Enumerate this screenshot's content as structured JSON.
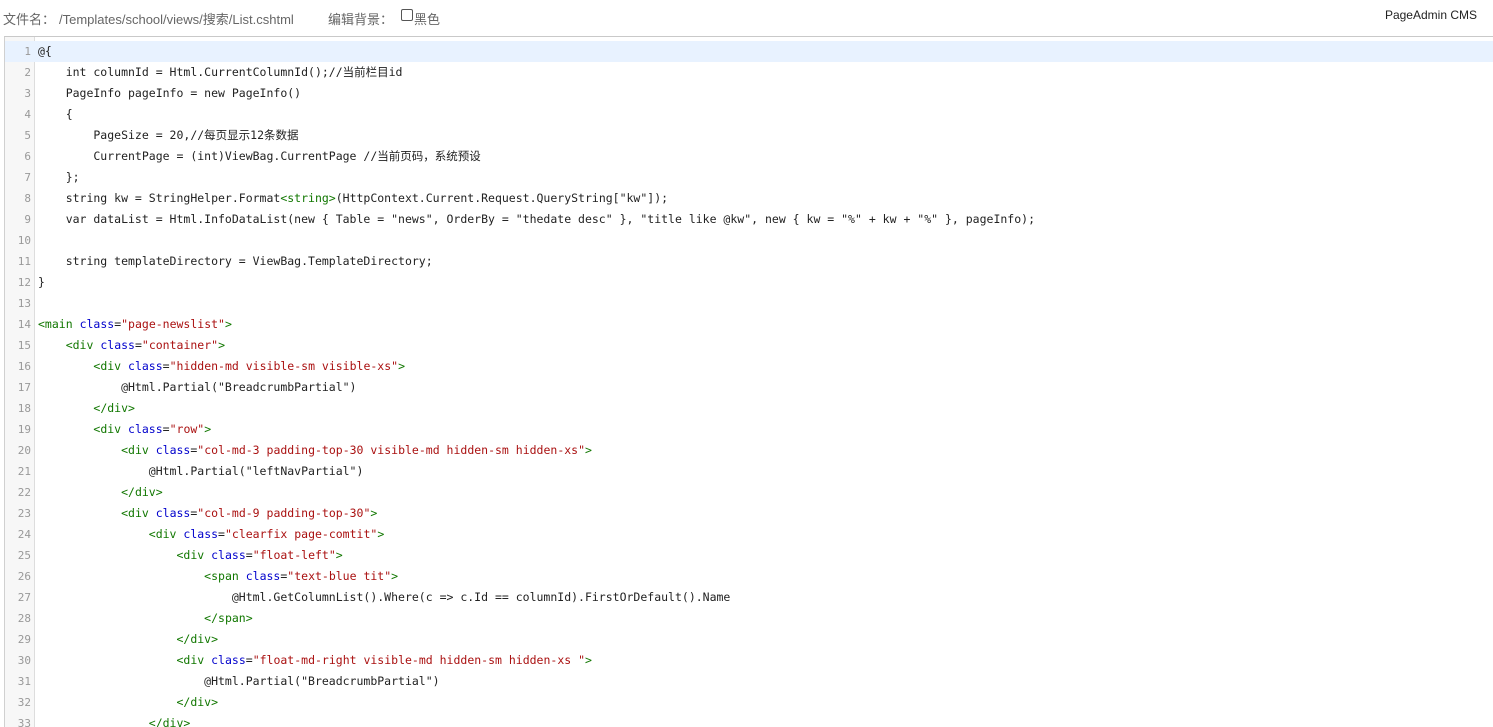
{
  "header": {
    "file_label": "文件名：",
    "file_path": "/Templates/school/views/搜索/List.cshtml",
    "bg_label": "编辑背景：",
    "bg_option": "黑色",
    "bg_checked": false,
    "brand": "PageAdmin CMS"
  },
  "editor": {
    "active_line": 1,
    "lines": [
      {
        "n": "1",
        "t": [
          [
            "",
            "@{"
          ]
        ]
      },
      {
        "n": "2",
        "t": [
          [
            "",
            "....int columnId = Html.CurrentColumnId();//当前栏目id"
          ]
        ]
      },
      {
        "n": "3",
        "t": [
          [
            "",
            "....PageInfo pageInfo = new PageInfo()"
          ]
        ]
      },
      {
        "n": "4",
        "t": [
          [
            "",
            "....{"
          ]
        ]
      },
      {
        "n": "5",
        "t": [
          [
            "",
            "........PageSize = 20,//每页显示12条数据"
          ]
        ]
      },
      {
        "n": "6",
        "t": [
          [
            "",
            "........CurrentPage = (int)ViewBag.CurrentPage //当前页码，系统预设"
          ]
        ]
      },
      {
        "n": "7",
        "t": [
          [
            "",
            "....};"
          ]
        ]
      },
      {
        "n": "8",
        "t": [
          [
            "",
            "....string kw = StringHelper.Format"
          ],
          [
            "tag",
            "<string>"
          ],
          [
            "",
            "(HttpContext.Current.Request.QueryString[\"kw\"]);"
          ]
        ]
      },
      {
        "n": "9",
        "t": [
          [
            "",
            "....var dataList = Html.InfoDataList(new { Table = \"news\", OrderBy = \"thedate desc\" }, \"title like @kw\", new { kw = \"%\" + kw + \"%\" }, pageInfo);"
          ]
        ]
      },
      {
        "n": "10",
        "t": []
      },
      {
        "n": "11",
        "t": [
          [
            "",
            "....string templateDirectory = ViewBag.TemplateDirectory;"
          ]
        ]
      },
      {
        "n": "12",
        "t": [
          [
            "",
            "}"
          ]
        ]
      },
      {
        "n": "13",
        "t": []
      },
      {
        "n": "14",
        "t": [
          [
            "tag",
            "<main"
          ],
          [
            "",
            " "
          ],
          [
            "attr",
            "class"
          ],
          [
            "",
            "="
          ],
          [
            "str",
            "\"page-newslist\""
          ],
          [
            "tag",
            ">"
          ]
        ]
      },
      {
        "n": "15",
        "t": [
          [
            "",
            "...."
          ],
          [
            "tag",
            "<div"
          ],
          [
            "",
            " "
          ],
          [
            "attr",
            "class"
          ],
          [
            "",
            "="
          ],
          [
            "str",
            "\"container\""
          ],
          [
            "tag",
            ">"
          ]
        ]
      },
      {
        "n": "16",
        "t": [
          [
            "",
            "........"
          ],
          [
            "tag",
            "<div"
          ],
          [
            "",
            " "
          ],
          [
            "attr",
            "class"
          ],
          [
            "",
            "="
          ],
          [
            "str",
            "\"hidden-md visible-sm visible-xs\""
          ],
          [
            "tag",
            ">"
          ]
        ]
      },
      {
        "n": "17",
        "t": [
          [
            "",
            "............@Html.Partial(\"BreadcrumbPartial\")"
          ]
        ]
      },
      {
        "n": "18",
        "t": [
          [
            "",
            "........"
          ],
          [
            "tag",
            "</div>"
          ]
        ]
      },
      {
        "n": "19",
        "t": [
          [
            "",
            "........"
          ],
          [
            "tag",
            "<div"
          ],
          [
            "",
            " "
          ],
          [
            "attr",
            "class"
          ],
          [
            "",
            "="
          ],
          [
            "str",
            "\"row\""
          ],
          [
            "tag",
            ">"
          ]
        ]
      },
      {
        "n": "20",
        "t": [
          [
            "",
            "............"
          ],
          [
            "tag",
            "<div"
          ],
          [
            "",
            " "
          ],
          [
            "attr",
            "class"
          ],
          [
            "",
            "="
          ],
          [
            "str",
            "\"col-md-3 padding-top-30 visible-md hidden-sm hidden-xs\""
          ],
          [
            "tag",
            ">"
          ]
        ]
      },
      {
        "n": "21",
        "t": [
          [
            "",
            "................@Html.Partial(\"leftNavPartial\")"
          ]
        ]
      },
      {
        "n": "22",
        "t": [
          [
            "",
            "............"
          ],
          [
            "tag",
            "</div>"
          ]
        ]
      },
      {
        "n": "23",
        "t": [
          [
            "",
            "............"
          ],
          [
            "tag",
            "<div"
          ],
          [
            "",
            " "
          ],
          [
            "attr",
            "class"
          ],
          [
            "",
            "="
          ],
          [
            "str",
            "\"col-md-9 padding-top-30\""
          ],
          [
            "tag",
            ">"
          ]
        ]
      },
      {
        "n": "24",
        "t": [
          [
            "",
            "................"
          ],
          [
            "tag",
            "<div"
          ],
          [
            "",
            " "
          ],
          [
            "attr",
            "class"
          ],
          [
            "",
            "="
          ],
          [
            "str",
            "\"clearfix page-comtit\""
          ],
          [
            "tag",
            ">"
          ]
        ]
      },
      {
        "n": "25",
        "t": [
          [
            "",
            "...................."
          ],
          [
            "tag",
            "<div"
          ],
          [
            "",
            " "
          ],
          [
            "attr",
            "class"
          ],
          [
            "",
            "="
          ],
          [
            "str",
            "\"float-left\""
          ],
          [
            "tag",
            ">"
          ]
        ]
      },
      {
        "n": "26",
        "t": [
          [
            "",
            "........................"
          ],
          [
            "tag",
            "<span"
          ],
          [
            "",
            " "
          ],
          [
            "attr",
            "class"
          ],
          [
            "",
            "="
          ],
          [
            "str",
            "\"text-blue tit\""
          ],
          [
            "tag",
            ">"
          ]
        ]
      },
      {
        "n": "27",
        "t": [
          [
            "",
            "............................@Html.GetColumnList().Where(c => c.Id == columnId).FirstOrDefault().Name"
          ]
        ]
      },
      {
        "n": "28",
        "t": [
          [
            "",
            "........................"
          ],
          [
            "tag",
            "</span>"
          ]
        ]
      },
      {
        "n": "29",
        "t": [
          [
            "",
            "...................."
          ],
          [
            "tag",
            "</div>"
          ]
        ]
      },
      {
        "n": "30",
        "t": [
          [
            "",
            "...................."
          ],
          [
            "tag",
            "<div"
          ],
          [
            "",
            " "
          ],
          [
            "attr",
            "class"
          ],
          [
            "",
            "="
          ],
          [
            "str",
            "\"float-md-right visible-md hidden-sm hidden-xs \""
          ],
          [
            "tag",
            ">"
          ]
        ]
      },
      {
        "n": "31",
        "t": [
          [
            "",
            "........................@Html.Partial(\"BreadcrumbPartial\")"
          ]
        ]
      },
      {
        "n": "32",
        "t": [
          [
            "",
            "...................."
          ],
          [
            "tag",
            "</div>"
          ]
        ]
      },
      {
        "n": "33",
        "t": [
          [
            "",
            "................"
          ],
          [
            "tag",
            "</div>"
          ]
        ]
      }
    ]
  }
}
